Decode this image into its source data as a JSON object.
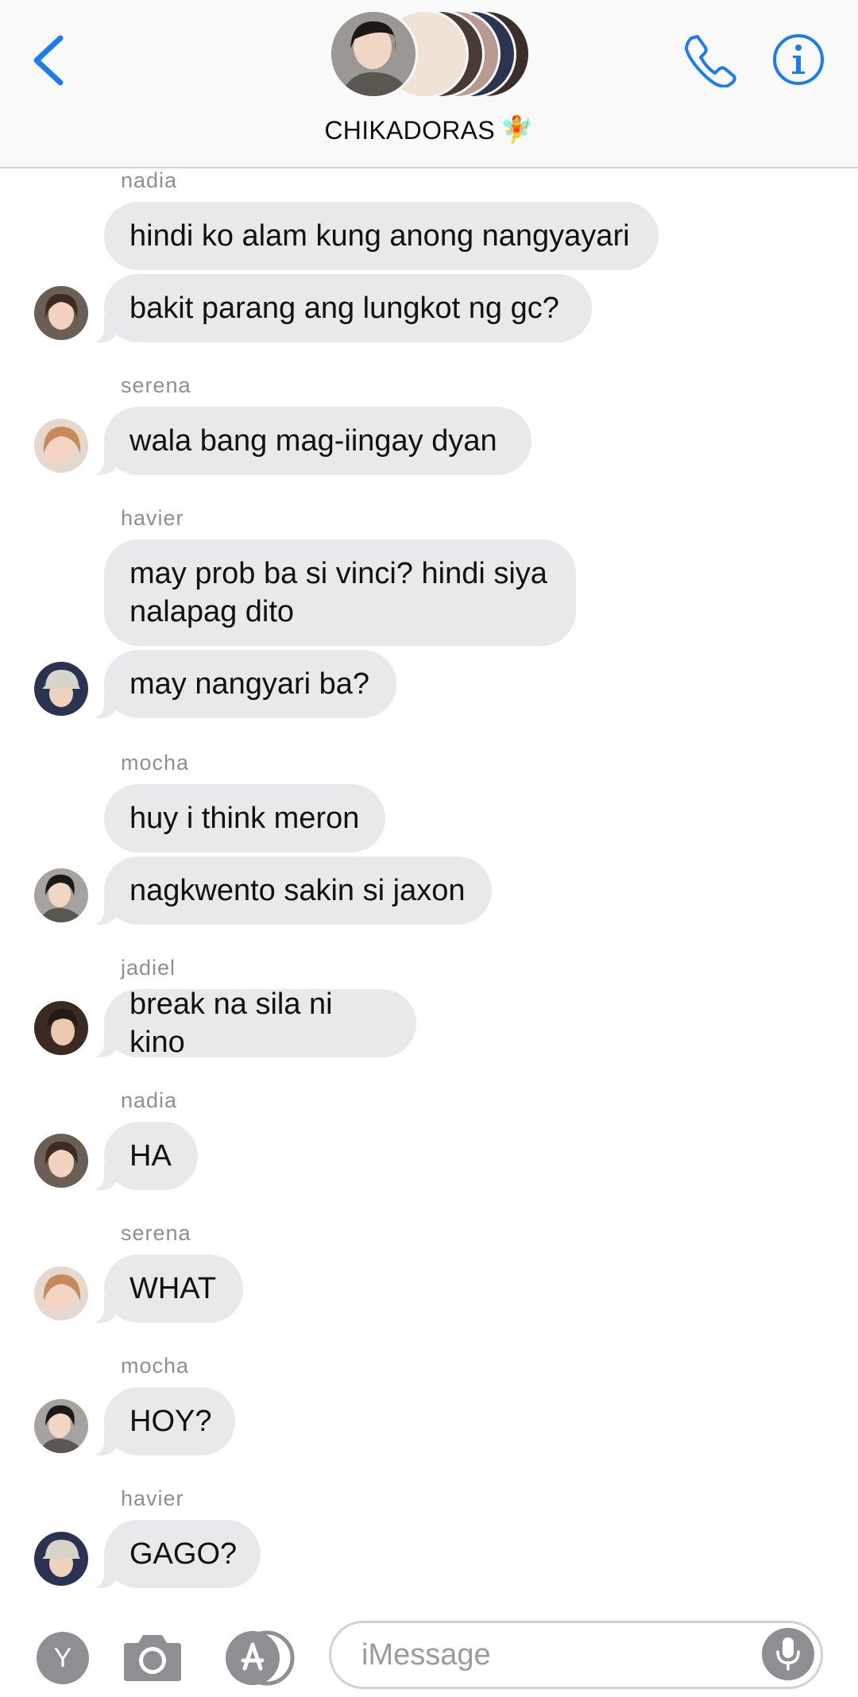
{
  "header": {
    "group_name": "CHIKADORAS",
    "group_emoji": "🧚",
    "accent_color": "#1b7cf2"
  },
  "messages": [
    {
      "sender": "nadia",
      "bubbles": [
        "hindi ko alam kung anong nangyayari",
        "bakit parang ang lungkot ng gc?"
      ]
    },
    {
      "sender": "serena",
      "bubbles": [
        "wala bang mag-iingay dyan"
      ]
    },
    {
      "sender": "havier",
      "bubbles": [
        "may prob ba si vinci? hindi siya nalapag dito",
        "may nangyari ba?"
      ]
    },
    {
      "sender": "mocha",
      "bubbles": [
        "huy i think meron",
        "nagkwento sakin si jaxon"
      ]
    },
    {
      "sender": "jadiel",
      "bubbles": [
        "break na sila ni kino"
      ]
    },
    {
      "sender": "nadia",
      "bubbles": [
        "HA"
      ]
    },
    {
      "sender": "serena",
      "bubbles": [
        "WHAT"
      ]
    },
    {
      "sender": "mocha",
      "bubbles": [
        "HOY?"
      ]
    },
    {
      "sender": "havier",
      "bubbles": [
        "GAGO?"
      ]
    }
  ],
  "input_bar": {
    "app_icon_letter": "Y",
    "placeholder": "iMessage"
  }
}
